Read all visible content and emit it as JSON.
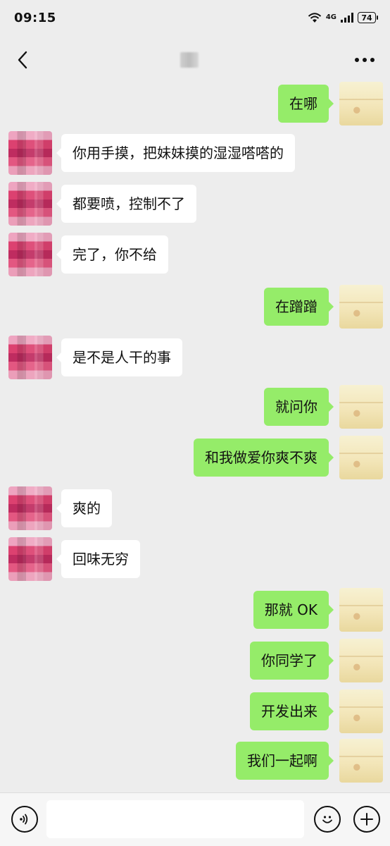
{
  "status": {
    "time": "09:15",
    "network": "4G",
    "battery": "74"
  },
  "header": {
    "back_icon": "chevron-left-icon",
    "more_icon": "more-horizontal-icon"
  },
  "messages": [
    {
      "from": "me",
      "text": "在哪"
    },
    {
      "from": "peer",
      "text": "你用手摸，把妹妹摸的湿湿嗒嗒的"
    },
    {
      "from": "peer",
      "text": "都要喷，控制不了"
    },
    {
      "from": "peer",
      "text": "完了，你不给"
    },
    {
      "from": "me",
      "text": "在蹭蹭"
    },
    {
      "from": "peer",
      "text": "是不是人干的事"
    },
    {
      "from": "me",
      "text": "就问你"
    },
    {
      "from": "me",
      "text": "和我做爱你爽不爽"
    },
    {
      "from": "peer",
      "text": "爽的"
    },
    {
      "from": "peer",
      "text": "回味无穷"
    },
    {
      "from": "me",
      "text": "那就 OK"
    },
    {
      "from": "me",
      "text": "你同学了"
    },
    {
      "from": "me",
      "text": "开发出来"
    },
    {
      "from": "me",
      "text": "我们一起啊"
    }
  ],
  "composer": {
    "input_value": "",
    "voice_icon": "voice-icon",
    "emoji_icon": "emoji-icon",
    "plus_icon": "plus-icon"
  },
  "colors": {
    "background": "#ededed",
    "me_bubble": "#95ec69",
    "peer_bubble": "#ffffff"
  }
}
